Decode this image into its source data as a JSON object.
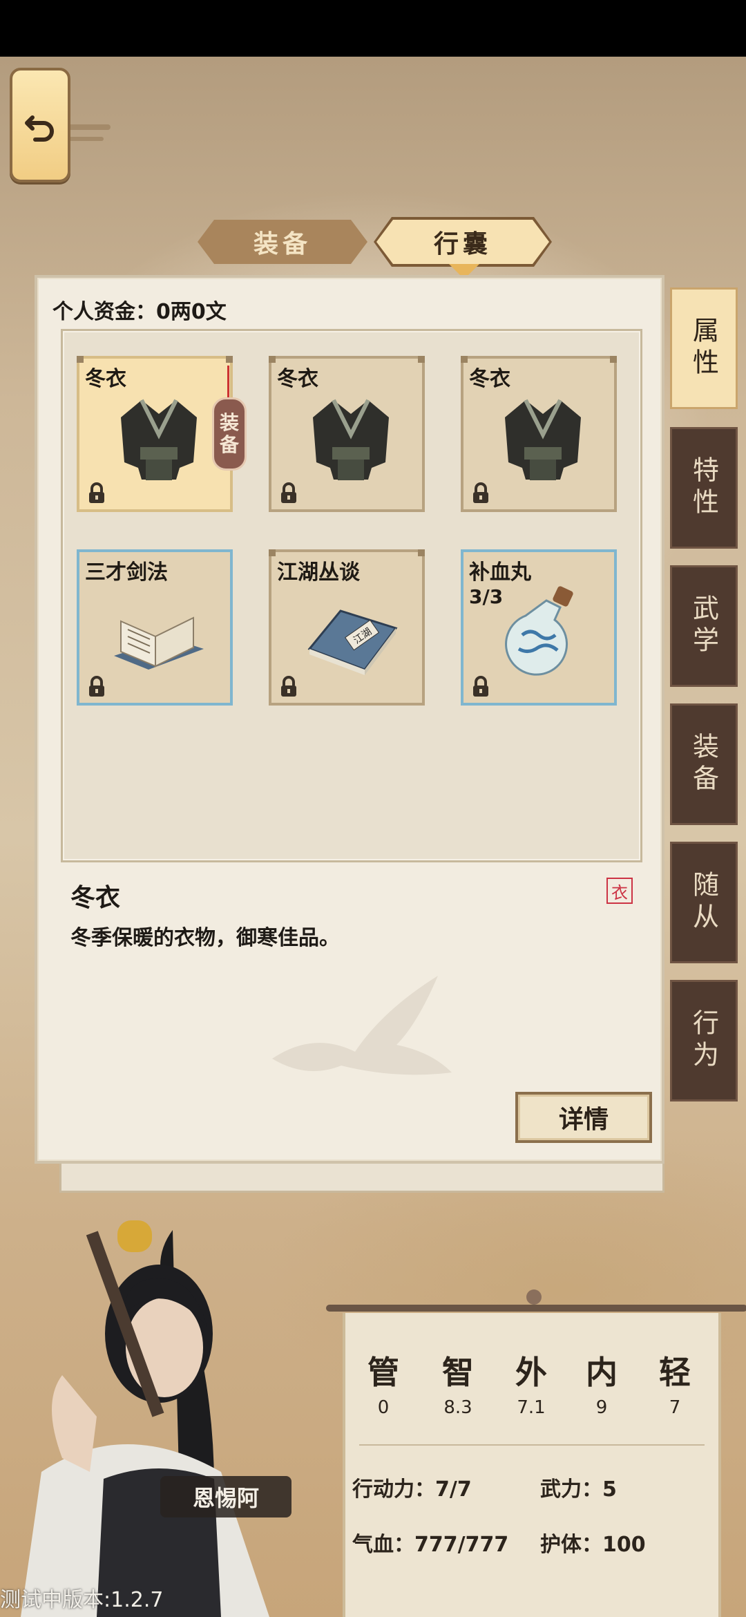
{
  "top_tabs": {
    "equip": "装备",
    "bag": "行囊"
  },
  "funds": {
    "label": "个人资金：0两0文"
  },
  "items": [
    {
      "name": "冬衣",
      "count": "",
      "equipped": true,
      "kind": "cloth"
    },
    {
      "name": "冬衣",
      "count": "",
      "equipped": false,
      "kind": "cloth"
    },
    {
      "name": "冬衣",
      "count": "",
      "equipped": false,
      "kind": "cloth"
    },
    {
      "name": "三才剑法",
      "count": "",
      "equipped": false,
      "kind": "manual"
    },
    {
      "name": "江湖丛谈",
      "count": "",
      "equipped": false,
      "kind": "book"
    },
    {
      "name": "补血丸",
      "count": "3/3",
      "equipped": false,
      "kind": "potion"
    }
  ],
  "equip_tag": {
    "line1": "装",
    "line2": "备"
  },
  "book_cover_text": "江湖",
  "detail": {
    "name": "冬衣",
    "type": "衣",
    "desc": "冬季保暖的衣物，御寒佳品。",
    "button": "详情"
  },
  "side_tabs": [
    {
      "label": "属性",
      "active": true
    },
    {
      "label": "特性",
      "active": false
    },
    {
      "label": "武学",
      "active": false
    },
    {
      "label": "装备",
      "active": false
    },
    {
      "label": "随从",
      "active": false
    },
    {
      "label": "行为",
      "active": false
    }
  ],
  "stats": {
    "attrs": [
      {
        "k": "管",
        "v": "0"
      },
      {
        "k": "智",
        "v": "8.3"
      },
      {
        "k": "外",
        "v": "7.1"
      },
      {
        "k": "内",
        "v": "9"
      },
      {
        "k": "轻",
        "v": "7"
      }
    ],
    "action": "行动力：7/7",
    "force": "武力：5",
    "hp": "气血：777/777",
    "guard": "护体：100"
  },
  "character_name": "恩惕阿",
  "version": "测试中版本:1.2.7",
  "colors": {
    "panel": "#f2ece0",
    "tab_active": "#f6e2b4",
    "tab_inactive": "#4f3a2f"
  }
}
